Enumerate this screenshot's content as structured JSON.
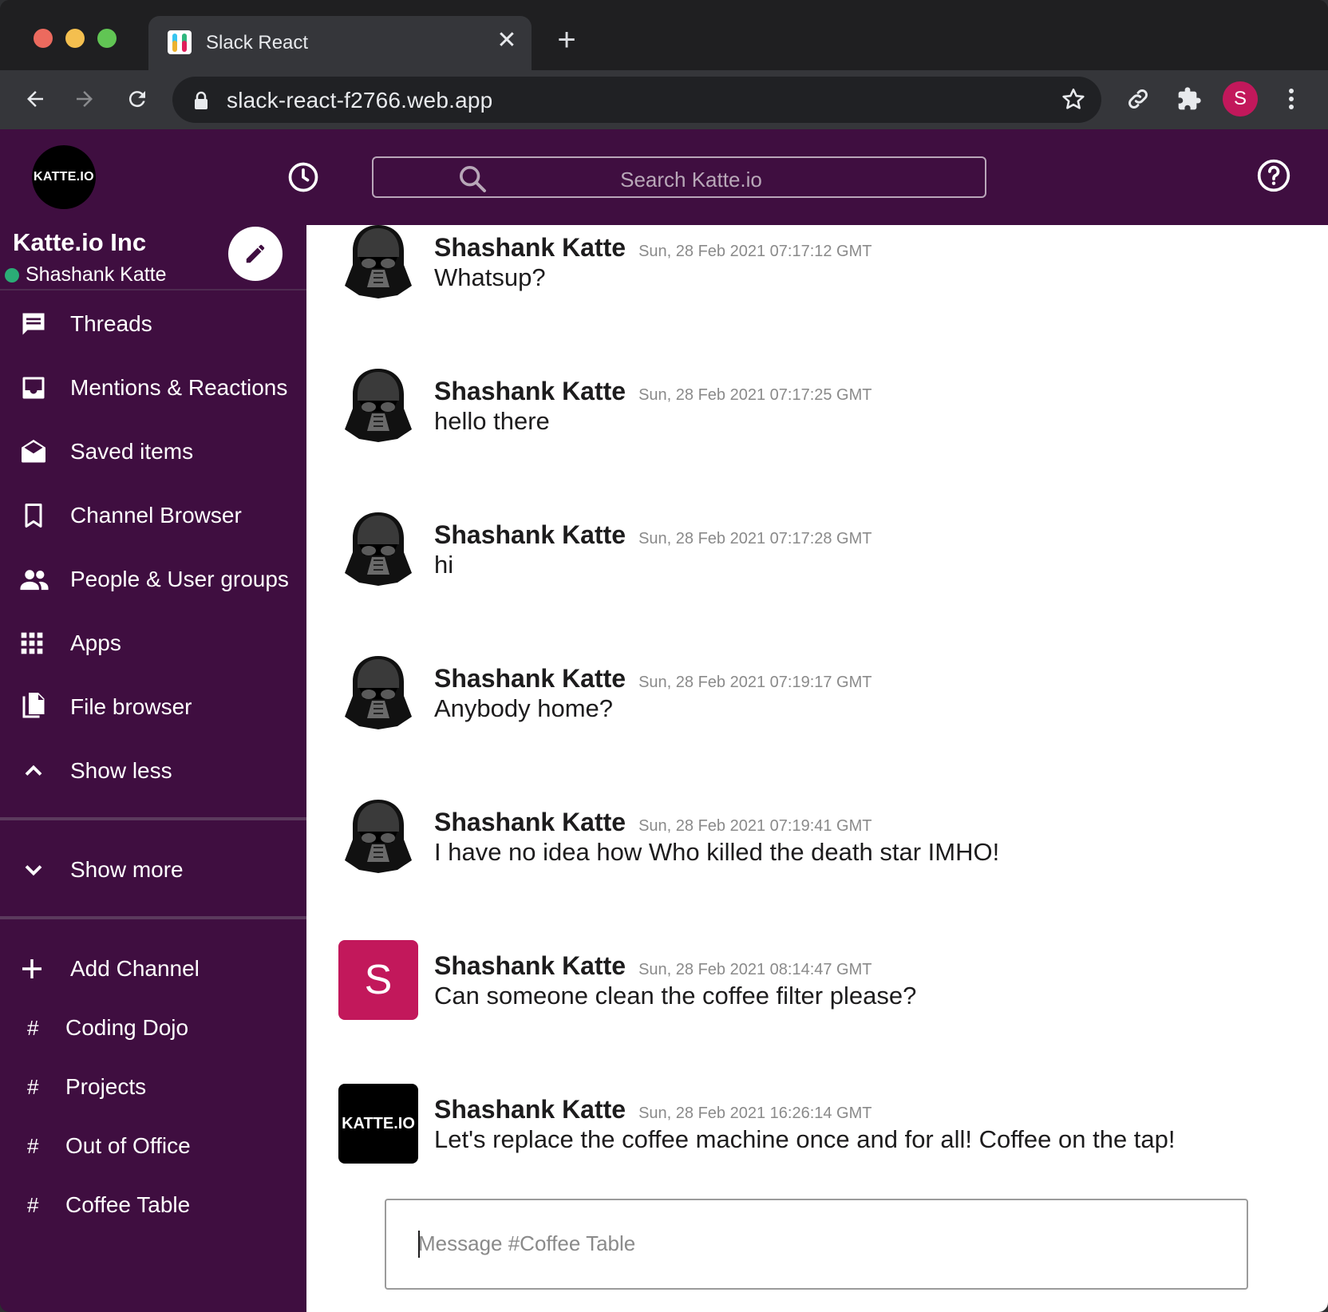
{
  "browser": {
    "tab_title": "Slack React",
    "url": "slack-react-f2766.web.app",
    "profile_initial": "S",
    "tab_close": "✕",
    "new_tab": "+"
  },
  "header": {
    "workspace_logo": "KATTE.IO",
    "search_placeholder": "Search Katte.io",
    "colors": {
      "header_bg": "#3f0e40",
      "sidebar_bg": "#3f0e40"
    }
  },
  "sidebar": {
    "workspace_name": "Katte.io Inc",
    "user_name": "Shashank Katte",
    "nav": [
      {
        "label": "Threads",
        "icon": "threads-icon"
      },
      {
        "label": "Mentions & Reactions",
        "icon": "inbox-icon"
      },
      {
        "label": "Saved items",
        "icon": "drafts-icon"
      },
      {
        "label": "Channel Browser",
        "icon": "bookmark-icon"
      },
      {
        "label": "People & User groups",
        "icon": "people-icon"
      },
      {
        "label": "Apps",
        "icon": "apps-grid-icon"
      },
      {
        "label": "File browser",
        "icon": "file-copy-icon"
      },
      {
        "label": "Show less",
        "icon": "chevron-up-icon"
      }
    ],
    "show_more": "Show more",
    "add_channel": "Add Channel",
    "channel_prefix": "#",
    "channels": [
      "Coding Dojo",
      "Projects",
      "Out of Office",
      "Coffee Table"
    ]
  },
  "messages": [
    {
      "author": "Shashank Katte",
      "time": "Sun, 28 Feb 2021 07:17:12 GMT",
      "text": "Whatsup?",
      "avatar": "vader-icon"
    },
    {
      "author": "Shashank Katte",
      "time": "Sun, 28 Feb 2021 07:17:25 GMT",
      "text": "hello there",
      "avatar": "vader-icon"
    },
    {
      "author": "Shashank Katte",
      "time": "Sun, 28 Feb 2021 07:17:28 GMT",
      "text": "hi",
      "avatar": "vader-icon"
    },
    {
      "author": "Shashank Katte",
      "time": "Sun, 28 Feb 2021 07:19:17 GMT",
      "text": "Anybody home?",
      "avatar": "vader-icon"
    },
    {
      "author": "Shashank Katte",
      "time": "Sun, 28 Feb 2021 07:19:41 GMT",
      "text": "I have no idea how Who killed the death star IMHO!",
      "avatar": "vader-icon"
    },
    {
      "author": "Shashank Katte",
      "time": "Sun, 28 Feb 2021 08:14:47 GMT",
      "text": "Can someone clean the coffee filter please?",
      "avatar": "S"
    },
    {
      "author": "Shashank Katte",
      "time": "Sun, 28 Feb 2021 16:26:14 GMT",
      "text": "Let's replace the coffee machine once and for all! Coffee on the tap!",
      "avatar": "KATTE.IO"
    }
  ],
  "composer": {
    "placeholder": "Message #Coffee Table"
  }
}
